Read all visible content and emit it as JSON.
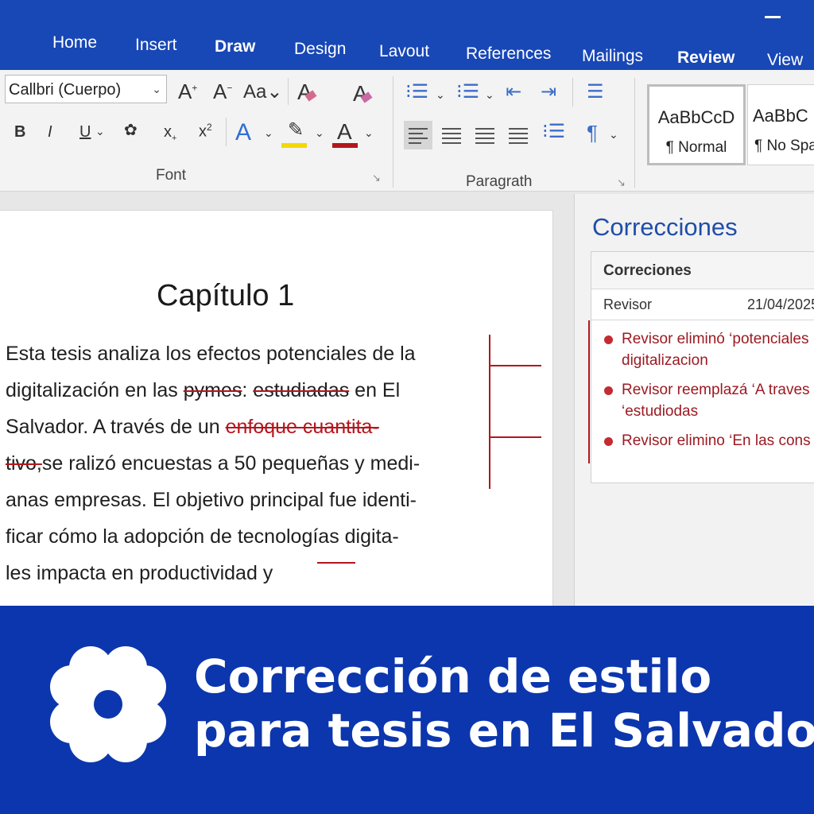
{
  "tabs": [
    "Home",
    "Insert",
    "Draw",
    "Design",
    "Lavout",
    "References",
    "Mailings",
    "Review",
    "View"
  ],
  "ribbon": {
    "font_name": "Callbri (Cuerpo)",
    "font_group_label": "Font",
    "paragraph_group_label": "Paragrath",
    "styles": [
      {
        "sample": "AaBbCcD",
        "name": "¶ Normal"
      },
      {
        "sample": "AaBbC",
        "name": "¶ No Spa"
      }
    ]
  },
  "document": {
    "heading": "Capítulo 1",
    "lines": [
      [
        "Esta tesis analiza los efectos potenciales de la"
      ],
      [
        "digitalización en las ",
        "pymes",
        ": ",
        "estudiadas",
        " en  El"
      ],
      [
        "Salvador.  A  través  de  un  ",
        "enfoque cuantita-"
      ],
      [
        "tivo,",
        "se ralizó encuestas a 50 pequeñas y medi-"
      ],
      [
        "anas empresas. El objetivo principal fue identi-"
      ],
      [
        "ficar  cómo  la  adopción  de  tecnologías  digita-"
      ],
      [
        "les impacta en productividad y"
      ]
    ]
  },
  "pane": {
    "title": "Correcciones",
    "card_title": "Correciones",
    "reviewer_label": "Revisor",
    "date": "21/04/2025",
    "items": [
      {
        "line1": "Revisor eliminó ‘potenciales",
        "line2": "digitalizacion"
      },
      {
        "line1": "Revisor reemplazá  ‘A traves",
        "line2": "‘estudiodas"
      },
      {
        "line1": "Revisor elimino ‘En las cons",
        "line2": ""
      }
    ]
  },
  "banner": {
    "line1": "Corrección de estilo",
    "line2": "para tesis en El Salvador"
  },
  "colors": {
    "brand_blue": "#0c36ad",
    "tab_blue": "#1847b6",
    "revision_red": "#b3161d",
    "pane_title_blue": "#1f4ea8"
  }
}
